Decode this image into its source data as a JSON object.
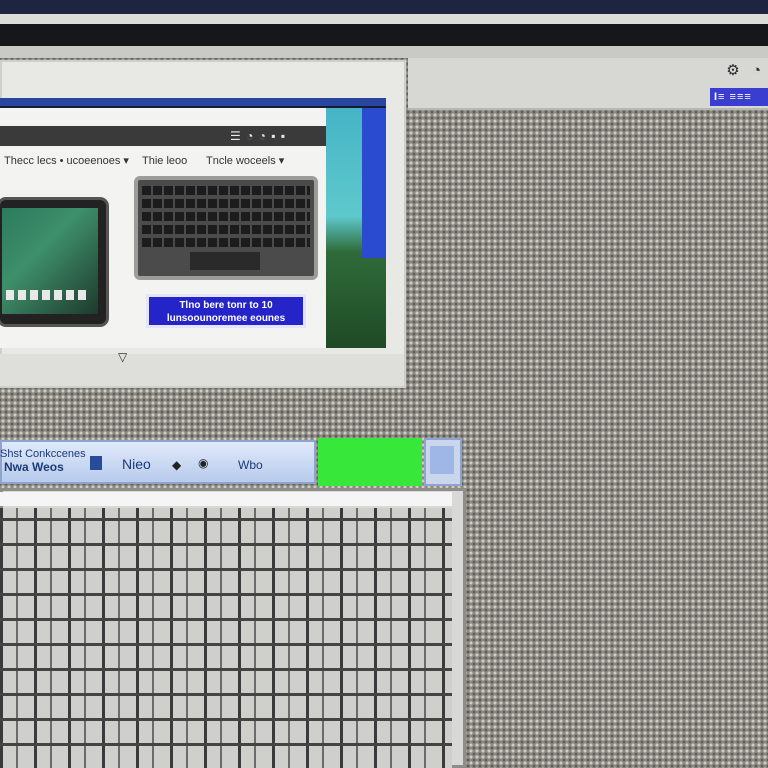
{
  "window_top": {
    "header_text": "☰ ◔ ◔ ▪ ▪",
    "nav": [
      "Thecc lecs  • ucoeenoes ▾",
      "Thie leoo",
      "Tncle woceels ▾"
    ],
    "cta_label": "Tlno bere tonr to 10 lunsoounoremee eounes",
    "footer_icon": "▽"
  },
  "toolbar": {
    "icon": "⚙",
    "icon2": "◔",
    "button_label": "I≡ ≡≡≡"
  },
  "window_bottom": {
    "title": "Shst Conkccenes",
    "subtitle": "Nwa Weos",
    "label": "Nieo",
    "label2": "Wbo",
    "icon2": "◆",
    "icon3": "◉"
  },
  "colors": {
    "accent_blue": "#2424c8",
    "green_button": "#37e83a",
    "desktop": "#8c8a84"
  }
}
